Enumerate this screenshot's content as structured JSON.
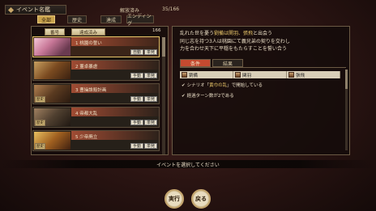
{
  "header": {
    "title": "イベント名鑑",
    "count_label": "解放済み",
    "count_value": "35/166"
  },
  "tabs": [
    {
      "label": "全部",
      "active": true
    },
    {
      "label": "歴史",
      "active": false
    },
    {
      "label": "達成",
      "active": false
    },
    {
      "label": "エンディング",
      "active": false
    }
  ],
  "list": {
    "filters": [
      "番号",
      "達成済み"
    ],
    "total": "166",
    "rows": [
      {
        "number": "1",
        "title": "桃園の誓い",
        "selected": true,
        "tag": "",
        "buttons": [
          "自動",
          "単発"
        ]
      },
      {
        "number": "2",
        "title": "董卓暴虐",
        "selected": false,
        "tag": "",
        "buttons": [
          "手動",
          "単発"
        ]
      },
      {
        "number": "3",
        "title": "曹操誅殺計画",
        "selected": false,
        "tag": "歴史",
        "buttons": [
          "手動",
          "単発"
        ]
      },
      {
        "number": "4",
        "title": "帝都大乱",
        "selected": false,
        "tag": "歴史",
        "buttons": [
          "手動",
          "単発"
        ]
      },
      {
        "number": "5",
        "title": "少帝廃立",
        "selected": false,
        "tag": "歴史",
        "buttons": [
          "手動",
          "単発"
        ]
      }
    ]
  },
  "detail": {
    "desc": [
      {
        "pre": "乱れた世を憂う",
        "hl": "劉備は関羽、張飛",
        "post": "と出会う"
      },
      {
        "pre": "同じ志を持つ3人は桃園にて義兄弟の契りを交わし",
        "hl": "",
        "post": ""
      },
      {
        "pre": "力を合わせ天下に平穏をもたらすことを誓い合う",
        "hl": "",
        "post": ""
      }
    ],
    "tabs": {
      "condition": "条件",
      "result": "結果"
    },
    "characters": [
      "劉備",
      "関羽",
      "張飛"
    ],
    "conditions": [
      {
        "check": "✔",
        "pre": "シナリオ「",
        "hl": "黄巾の乱",
        "post": "」で開始している"
      },
      {
        "check": "✔",
        "pre": "経過ターン数が2である",
        "hl": "",
        "post": ""
      }
    ]
  },
  "bottom": {
    "prompt": "イベントを選択してください",
    "execute": "実行",
    "back": "戻る"
  },
  "colors": {
    "accent": "#c8a24c",
    "selected_tab": "#c44a30",
    "highlight": "#e8c66a"
  }
}
